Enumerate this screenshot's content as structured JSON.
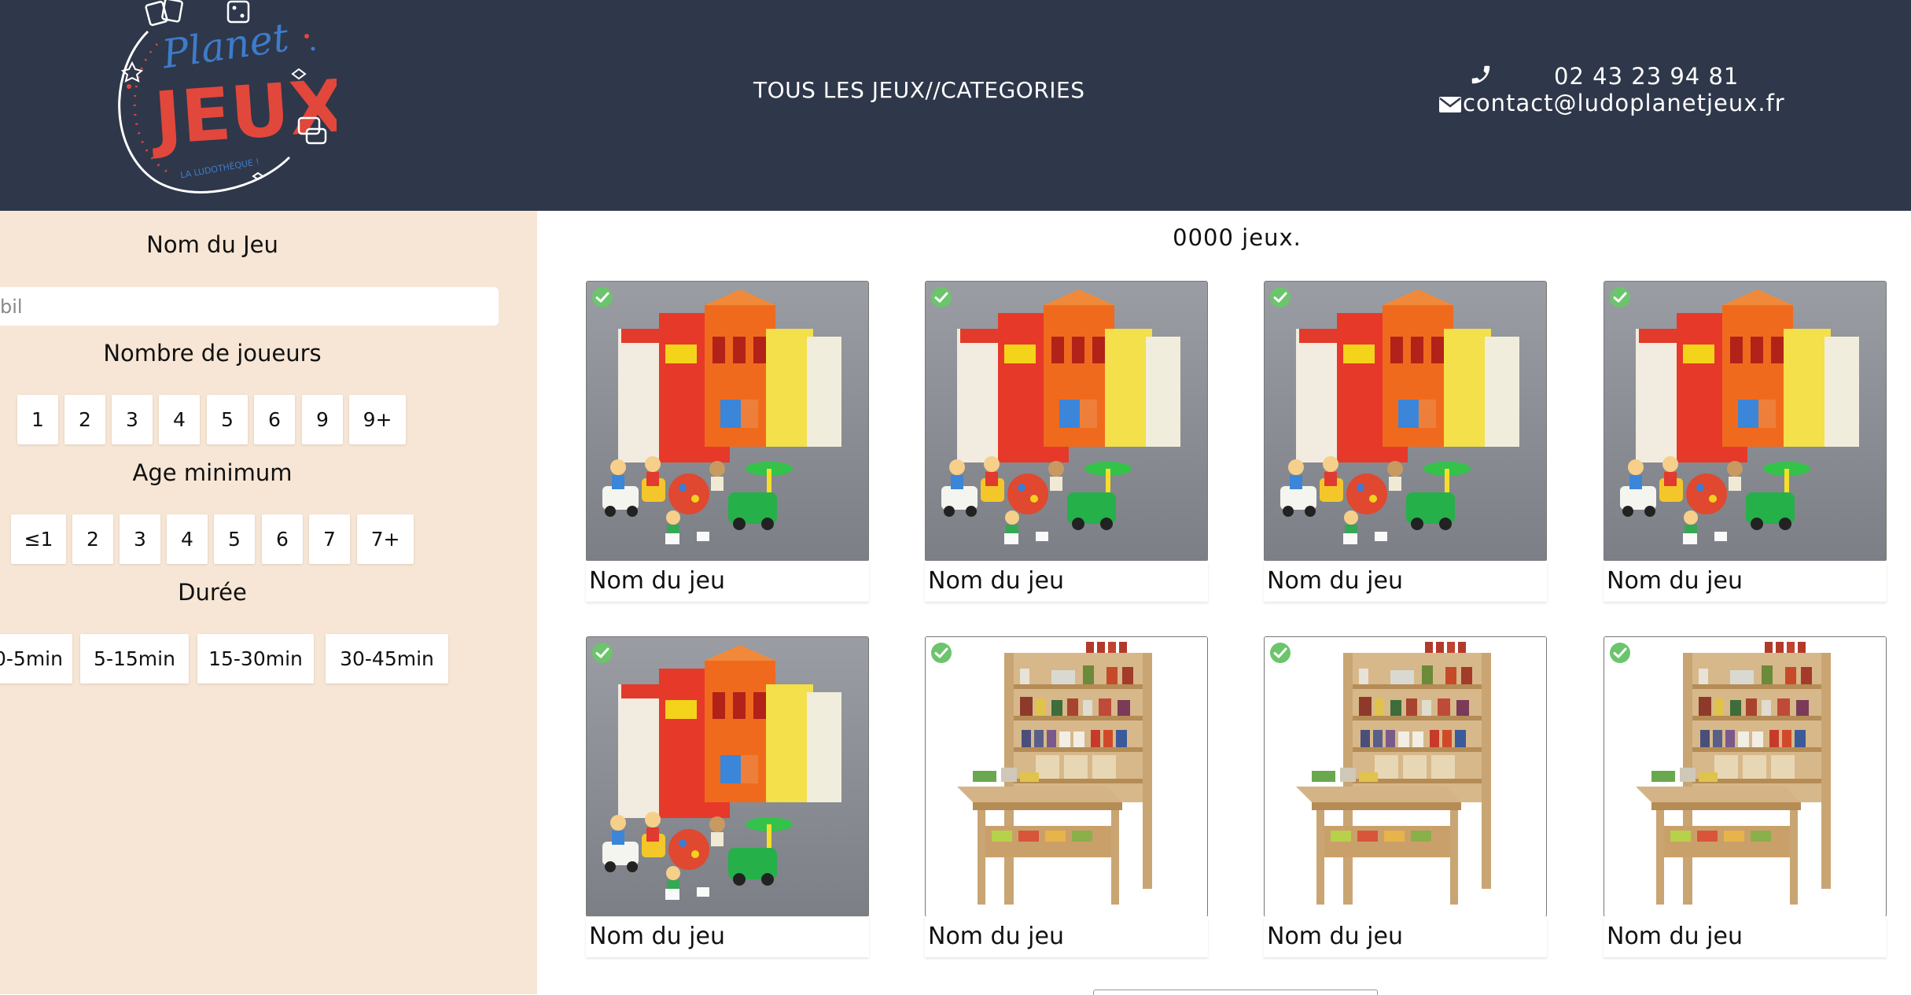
{
  "header": {
    "nav_label": "TOUS LES JEUX//CATEGORIES",
    "phone": "02 43 23 94 81",
    "email": "contact@ludoplanetjeux.fr",
    "logo": {
      "line1": "Planet",
      "line2": "JEUX",
      "tagline": "LA LUDOTHÈQUE !"
    }
  },
  "sidebar": {
    "name_title": "Nom du Jeu",
    "search_placeholder": "bil",
    "players_title": "Nombre de joueurs",
    "players": [
      "1",
      "2",
      "3",
      "4",
      "5",
      "6",
      "9",
      "9+"
    ],
    "age_title": "Age minimum",
    "ages": [
      "≤1",
      "2",
      "3",
      "4",
      "5",
      "6",
      "7",
      "7+"
    ],
    "duration_title": "Durée",
    "durations": [
      "0-5min",
      "5-15min",
      "15-30min",
      "30-45min"
    ]
  },
  "main": {
    "count_label": "0000 jeux.",
    "games": [
      {
        "name": "Nom du jeu",
        "image": "toy-building"
      },
      {
        "name": "Nom du jeu",
        "image": "toy-building"
      },
      {
        "name": "Nom du jeu",
        "image": "toy-building"
      },
      {
        "name": "Nom du jeu",
        "image": "toy-building"
      },
      {
        "name": "Nom du jeu",
        "image": "toy-building"
      },
      {
        "name": "Nom du jeu",
        "image": "toy-shop-stand"
      },
      {
        "name": "Nom du jeu",
        "image": "toy-shop-stand"
      },
      {
        "name": "Nom du jeu",
        "image": "toy-shop-stand"
      }
    ]
  },
  "colors": {
    "header_bg": "#2f374a",
    "sidebar_bg": "#f7e6d5",
    "check_green": "#6cc46c",
    "logo_red": "#e2473b",
    "logo_blue": "#3d7cc9"
  }
}
